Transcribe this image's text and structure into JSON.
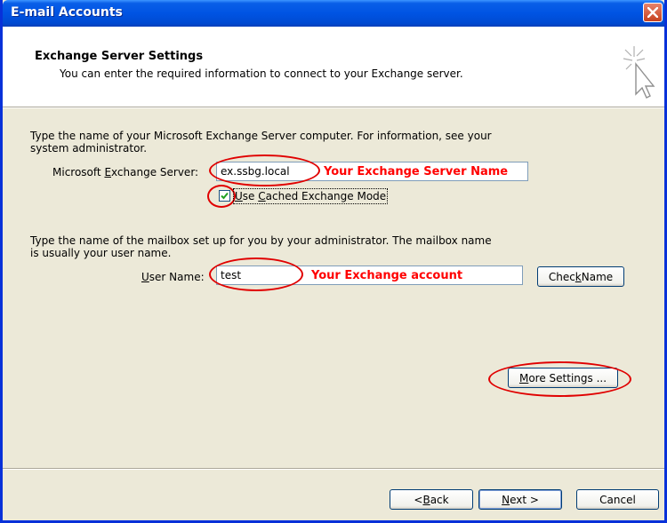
{
  "window": {
    "title": "E-mail Accounts"
  },
  "header": {
    "title": "Exchange Server Settings",
    "subtitle": "You can enter the required information to connect to your Exchange server."
  },
  "server_section": {
    "instruction_line1": "Type the name of your Microsoft Exchange Server computer. For information, see your",
    "instruction_line2": "system administrator.",
    "label_pre": "Microsoft ",
    "label_key": "E",
    "label_post": "xchange Server:",
    "value": "ex.ssbg.local",
    "annotation": "Your Exchange Server Name",
    "cached_mode": {
      "label_key": "U",
      "label_post": "se ",
      "label_key2": "C",
      "label_rest": "ached Exchange Mode",
      "checked": true
    }
  },
  "mailbox_section": {
    "instruction_line1": "Type the name of the mailbox set up for you by your administrator. The mailbox name",
    "instruction_line2": "is usually your user name.",
    "label_key": "U",
    "label_post": "ser Name:",
    "value": "test",
    "annotation": "Your Exchange account",
    "check_name_pre": "Chec",
    "check_name_key": "k",
    "check_name_post": " Name"
  },
  "more_settings": {
    "label_key": "M",
    "label_post": "ore Settings ..."
  },
  "footer": {
    "back_pre": "< ",
    "back_key": "B",
    "back_post": "ack",
    "next_key": "N",
    "next_post": "ext >",
    "cancel": "Cancel"
  },
  "colors": {
    "titlebar": "#0054e3",
    "annotation": "#ff0000",
    "dialog_bg": "#ece9d8"
  }
}
